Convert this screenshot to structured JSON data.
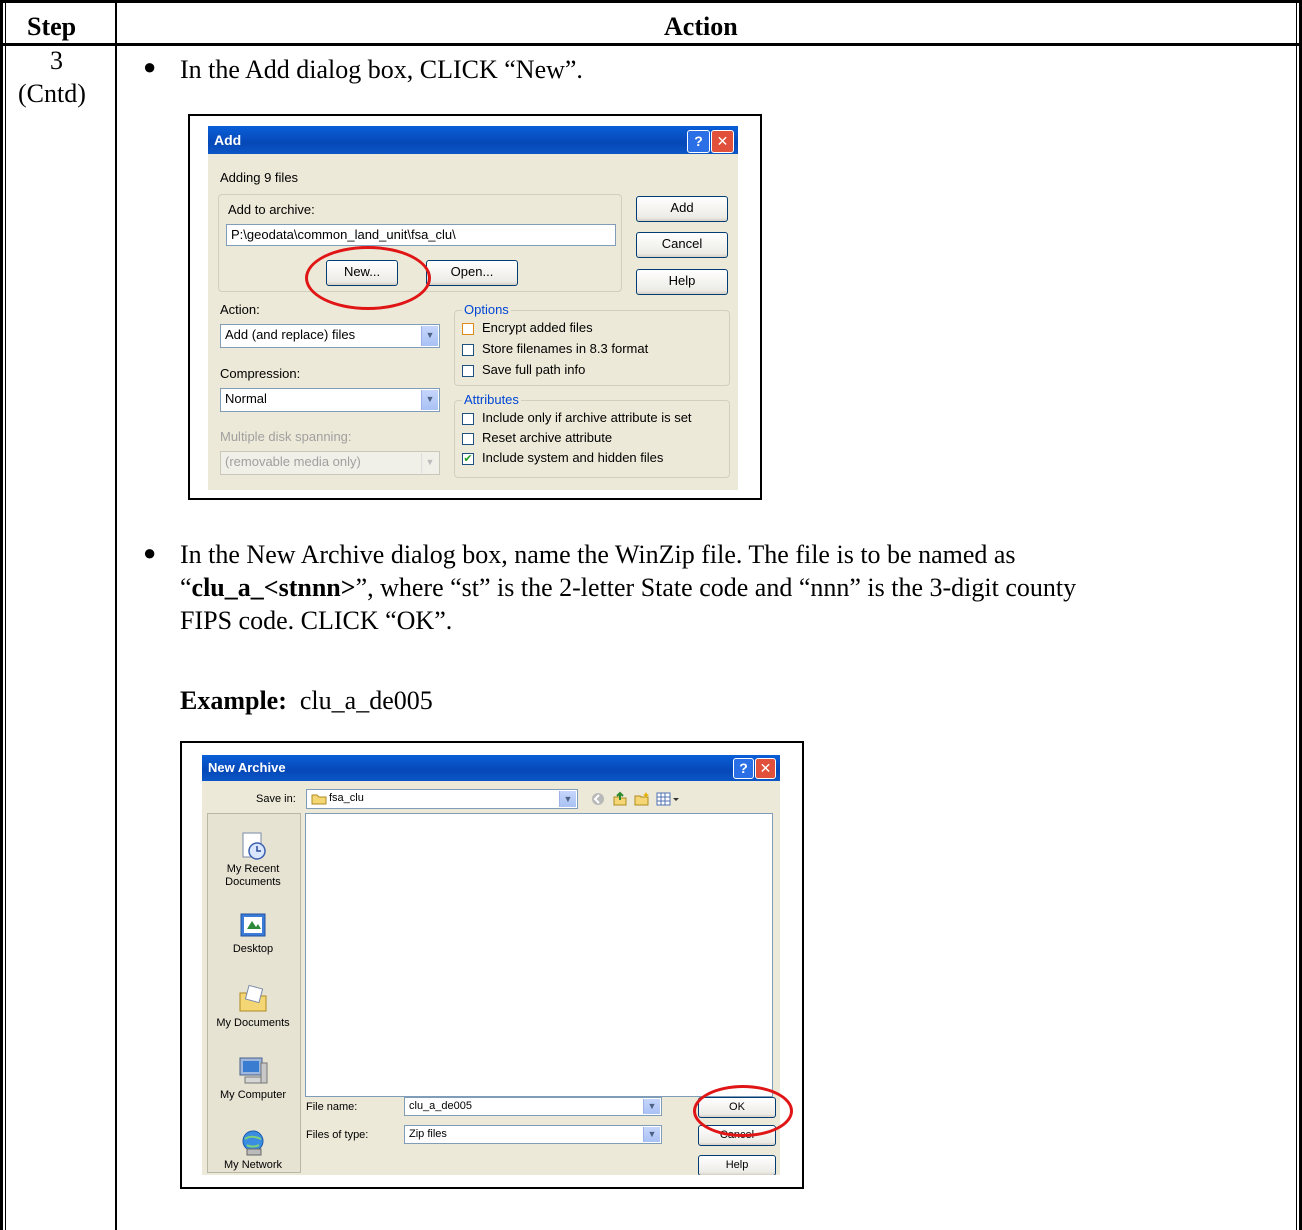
{
  "table": {
    "col_step": "Step",
    "col_action": "Action",
    "step_number": "3",
    "step_cont": "(Cntd)"
  },
  "bullet1": {
    "text": "In the Add dialog box, CLICK “New”."
  },
  "add_dialog": {
    "title": "Add",
    "subtitle": "Adding 9 files",
    "add_to_archive_label": "Add to archive:",
    "archive_path": "P:\\geodata\\common_land_unit\\fsa_clu\\",
    "new_button": "New...",
    "open_button": "Open...",
    "add_button": "Add",
    "cancel_button": "Cancel",
    "help_button": "Help",
    "action_label": "Action:",
    "action_value": "Add (and replace) files",
    "compression_label": "Compression:",
    "compression_value": "Normal",
    "spanning_label": "Multiple disk spanning:",
    "spanning_value": "(removable media only)",
    "options_label": "Options",
    "opt_encrypt": "Encrypt added files",
    "opt_83": "Store filenames in 8.3 format",
    "opt_fullpath": "Save full path info",
    "attributes_label": "Attributes",
    "attr_only": "Include only if archive attribute is set",
    "attr_reset": "Reset archive attribute",
    "attr_system": "Include system and hidden files"
  },
  "bullet2": {
    "line1": "In the New Archive dialog box, name the WinZip file.  The file is to be named as",
    "open_quote": "“",
    "bold_name": "clu_a_<stnnn>",
    "line2_rest": "”, where “st” is the 2-letter State code and “nnn” is the 3-digit county",
    "line3": "FIPS code.  CLICK “OK”.",
    "example_label": "Example:",
    "example_value": "clu_a_de005"
  },
  "new_archive_dialog": {
    "title": "New Archive",
    "save_in_label": "Save in:",
    "save_in_value": "fsa_clu",
    "places": [
      "My Recent Documents",
      "Desktop",
      "My Documents",
      "My Computer",
      "My Network"
    ],
    "file_name_label": "File name:",
    "file_name_value": "clu_a_de005",
    "files_of_type_label": "Files of type:",
    "files_of_type_value": "Zip files",
    "ok_button": "OK",
    "cancel_button": "Cancel",
    "help_button": "Help"
  }
}
